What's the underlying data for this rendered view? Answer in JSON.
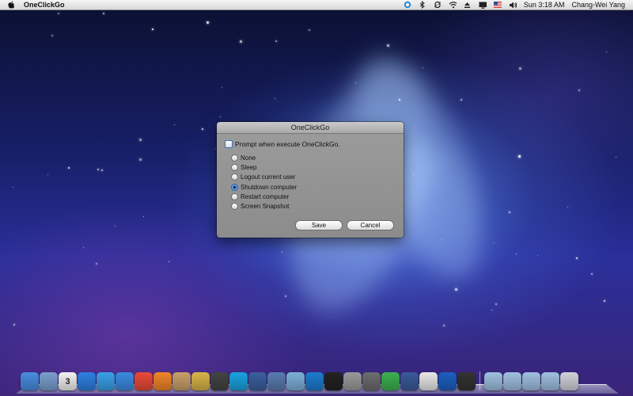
{
  "menubar": {
    "app_name": "OneClickGo",
    "clock": "Sun 3:18 AM",
    "username": "Chang-Wei Yang",
    "status_icons": [
      "app-status-icon",
      "bluetooth-icon",
      "sync-icon",
      "wifi-icon",
      "eject-icon",
      "display-icon",
      "us-flag-icon",
      "volume-icon"
    ]
  },
  "dialog": {
    "title": "OneClickGo",
    "prompt_label": "Prompt when execute OneClickGo.",
    "prompt_checked": false,
    "options": [
      {
        "label": "None",
        "checked": false
      },
      {
        "label": "Sleep",
        "checked": false
      },
      {
        "label": "Logout current user",
        "checked": false
      },
      {
        "label": "Shutdown computer",
        "checked": true
      },
      {
        "label": "Restart computer",
        "checked": false
      },
      {
        "label": "Screen Snapshot",
        "checked": false
      }
    ],
    "save_label": "Save",
    "cancel_label": "Cancel"
  },
  "dock": {
    "calendar_day": "3",
    "apps": [
      {
        "name": "finder-icon",
        "color": "#4a8de0"
      },
      {
        "name": "preview-icon",
        "color": "#7a9fcf"
      },
      {
        "name": "calendar-icon",
        "color": "#f2f2f2"
      },
      {
        "name": "app-store-icon",
        "color": "#2f7fe0"
      },
      {
        "name": "itunes-icon",
        "color": "#3aa0e8"
      },
      {
        "name": "safari-icon",
        "color": "#3b8be0"
      },
      {
        "name": "chrome-icon",
        "color": "#e84a3a"
      },
      {
        "name": "firefox-icon",
        "color": "#f0852a"
      },
      {
        "name": "photos-icon",
        "color": "#c9a06a"
      },
      {
        "name": "paintbrush-icon",
        "color": "#d7b44a"
      },
      {
        "name": "media-player-icon",
        "color": "#444444"
      },
      {
        "name": "skype-icon",
        "color": "#1aa3e0"
      },
      {
        "name": "virtualbox-icon",
        "color": "#3b5fa0"
      },
      {
        "name": "xcode-icon",
        "color": "#5a7bb0"
      },
      {
        "name": "network-icon",
        "color": "#7fb0d8"
      },
      {
        "name": "teamviewer-icon",
        "color": "#1d7ccf"
      },
      {
        "name": "terminal-icon",
        "color": "#222222"
      },
      {
        "name": "calculator-icon",
        "color": "#9a9a9a"
      },
      {
        "name": "system-preferences-icon",
        "color": "#6d6d6d"
      },
      {
        "name": "messenger-icon",
        "color": "#3db050"
      },
      {
        "name": "keyboard-icon",
        "color": "#3a5a9a"
      },
      {
        "name": "grid-app-icon",
        "color": "#e8e8e8"
      },
      {
        "name": "power-icon",
        "color": "#1d5fc0"
      },
      {
        "name": "screen-capture-icon",
        "color": "#333333"
      }
    ],
    "stacks": [
      {
        "name": "folder-icon",
        "color": "#9fc0e0"
      },
      {
        "name": "downloads-folder-icon",
        "color": "#9fc0e0"
      },
      {
        "name": "applications-folder-icon",
        "color": "#9fc0e0"
      },
      {
        "name": "documents-folder-icon",
        "color": "#9fc0e0"
      },
      {
        "name": "trash-icon",
        "color": "#cfd4da"
      }
    ]
  }
}
